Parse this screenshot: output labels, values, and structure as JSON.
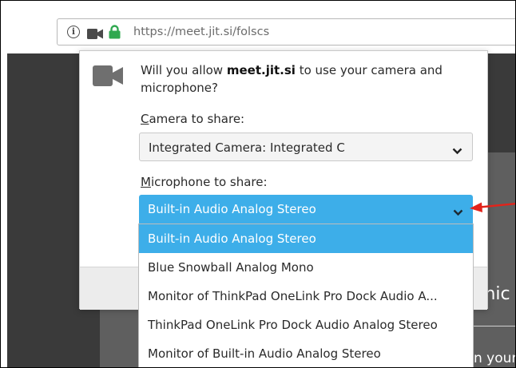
{
  "browser": {
    "url": "https://meet.jit.si/folscs"
  },
  "popup": {
    "question_prefix": "Will you allow ",
    "question_site": "meet.jit.si",
    "question_suffix": " to use your camera and microphone?",
    "camera_label_accesskey": "C",
    "camera_label_rest": "amera to share:",
    "camera_selected": "Integrated Camera: Integrated C",
    "mic_label_accesskey": "M",
    "mic_label_rest": "icrophone to share:",
    "mic_selected": "Built-in Audio Analog Stereo"
  },
  "mic_options": [
    "Built-in Audio Analog Stereo",
    "Blue Snowball Analog Mono",
    "Monitor of ThinkPad OneLink Pro Dock Audio A...",
    "ThinkPad OneLink Pro Dock Audio Analog Stereo",
    "Monitor of Built-in Audio Analog Stereo"
  ],
  "page_behind": {
    "partial_text_1": "mic",
    "partial_text_2": "n your"
  },
  "colors": {
    "accent": "#3daee9",
    "lock_green": "#2fa84f",
    "annotation_red": "#e2231a"
  }
}
